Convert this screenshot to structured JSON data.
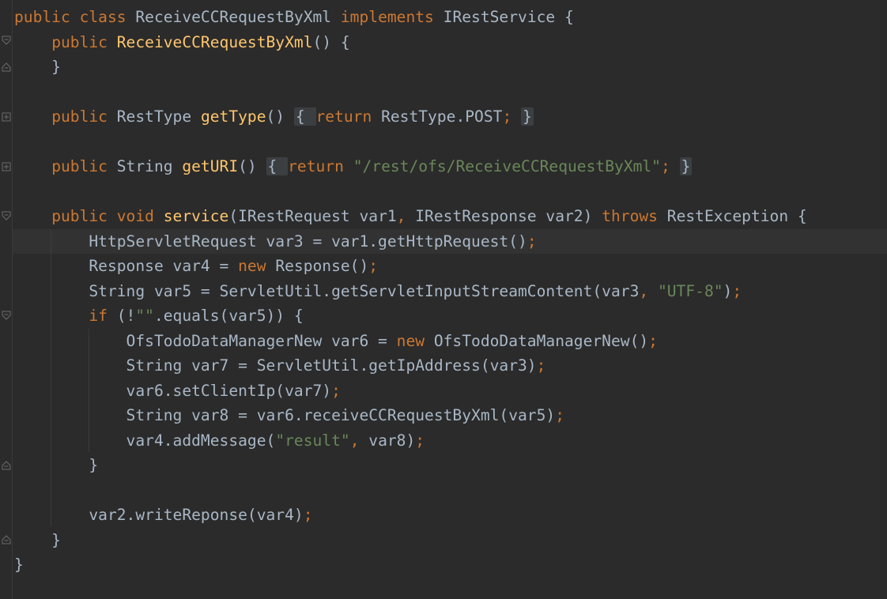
{
  "editor": {
    "theme": "darcula",
    "colors": {
      "background": "#2b2b2b",
      "keyword": "#cc7832",
      "function": "#ffc66d",
      "string": "#6a8759",
      "plain": "#a9b7c6",
      "current_line": "#323232"
    },
    "lines": [
      [
        [
          "kw",
          "public "
        ],
        [
          "kw",
          "class "
        ],
        [
          "pl",
          "ReceiveCCRequestByXml "
        ],
        [
          "kw",
          "implements "
        ],
        [
          "pl",
          "IRestService {"
        ]
      ],
      [
        [
          "pl",
          "    "
        ],
        [
          "kw",
          "public "
        ],
        [
          "fn",
          "ReceiveCCRequestByXml"
        ],
        [
          "pl",
          "() {"
        ]
      ],
      [
        [
          "pl",
          "    }"
        ]
      ],
      [],
      [
        [
          "pl",
          "    "
        ],
        [
          "kw",
          "public "
        ],
        [
          "pl",
          "RestType "
        ],
        [
          "fn",
          "getType"
        ],
        [
          "pl",
          "() "
        ],
        [
          "box",
          "{ "
        ],
        [
          "kw",
          "return "
        ],
        [
          "pl",
          "RestType.POST"
        ],
        [
          "kw",
          "; "
        ],
        [
          "box",
          "}"
        ]
      ],
      [],
      [
        [
          "pl",
          "    "
        ],
        [
          "kw",
          "public "
        ],
        [
          "pl",
          "String "
        ],
        [
          "fn",
          "getURI"
        ],
        [
          "pl",
          "() "
        ],
        [
          "box",
          "{ "
        ],
        [
          "kw",
          "return "
        ],
        [
          "str",
          "\"/rest/ofs/ReceiveCCRequestByXml\""
        ],
        [
          "kw",
          "; "
        ],
        [
          "box",
          "}"
        ]
      ],
      [],
      [
        [
          "pl",
          "    "
        ],
        [
          "kw",
          "public "
        ],
        [
          "kw",
          "void "
        ],
        [
          "fn",
          "service"
        ],
        [
          "pl",
          "(IRestRequest var1"
        ],
        [
          "kw",
          ", "
        ],
        [
          "pl",
          "IRestResponse var2) "
        ],
        [
          "kw",
          "throws "
        ],
        [
          "pl",
          "RestException {"
        ]
      ],
      [
        [
          "pl",
          "        HttpServletRequest var3 = var1.getHttpRequest()"
        ],
        [
          "kw",
          ";"
        ]
      ],
      [
        [
          "pl",
          "        Response var4 = "
        ],
        [
          "kw",
          "new "
        ],
        [
          "pl",
          "Response()"
        ],
        [
          "kw",
          ";"
        ]
      ],
      [
        [
          "pl",
          "        String var5 = ServletUtil.getServletInputStreamContent(var3"
        ],
        [
          "kw",
          ", "
        ],
        [
          "str",
          "\"UTF-8\""
        ],
        [
          "pl",
          ")"
        ],
        [
          "kw",
          ";"
        ]
      ],
      [
        [
          "pl",
          "        "
        ],
        [
          "kw",
          "if "
        ],
        [
          "pl",
          "(!"
        ],
        [
          "str",
          "\"\""
        ],
        [
          "pl",
          ".equals(var5)) {"
        ]
      ],
      [
        [
          "pl",
          "            OfsTodoDataManagerNew var6 = "
        ],
        [
          "kw",
          "new "
        ],
        [
          "pl",
          "OfsTodoDataManagerNew()"
        ],
        [
          "kw",
          ";"
        ]
      ],
      [
        [
          "pl",
          "            String var7 = ServletUtil.getIpAddress(var3)"
        ],
        [
          "kw",
          ";"
        ]
      ],
      [
        [
          "pl",
          "            var6.setClientIp(var7)"
        ],
        [
          "kw",
          ";"
        ]
      ],
      [
        [
          "pl",
          "            String var8 = var6.receiveCCRequestByXml(var5)"
        ],
        [
          "kw",
          ";"
        ]
      ],
      [
        [
          "pl",
          "            var4.addMessage("
        ],
        [
          "str",
          "\"result\""
        ],
        [
          "kw",
          ", "
        ],
        [
          "pl",
          "var8)"
        ],
        [
          "kw",
          ";"
        ]
      ],
      [
        [
          "pl",
          "        }"
        ]
      ],
      [],
      [
        [
          "pl",
          "        var2.writeReponse(var4)"
        ],
        [
          "kw",
          ";"
        ]
      ],
      [
        [
          "pl",
          "    }"
        ]
      ],
      [
        [
          "pl",
          "}"
        ]
      ]
    ]
  }
}
